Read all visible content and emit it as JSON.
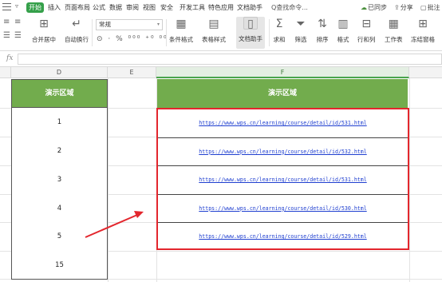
{
  "menubar": {
    "start_tab": "开始",
    "items": [
      "插入",
      "页面布局",
      "公式",
      "数据",
      "审阅",
      "视图",
      "安全",
      "开发工具",
      "特色应用",
      "文档助手"
    ],
    "search_placeholder": "Q查找命令...",
    "sync_label": "已同步",
    "share_label": "分享",
    "comment_label": "批注"
  },
  "ribbon": {
    "merge_center": "合并居中",
    "wrap_text": "自动换行",
    "number_format": "常规",
    "conditional_format": "条件格式",
    "table_style": "表格样式",
    "doc_helper": "文档助手",
    "sum": "求和",
    "filter": "筛选",
    "sort": "排序",
    "format": "格式",
    "row_col": "行和列",
    "worksheet": "工作表",
    "freeze": "冻结窗格"
  },
  "formula_bar": {
    "fx_label": "fx",
    "value": ""
  },
  "columns": {
    "d": "D",
    "e": "E",
    "f": "F"
  },
  "table_d": {
    "header": "演示区域",
    "values": [
      "1",
      "2",
      "3",
      "4",
      "5",
      "15"
    ]
  },
  "table_f": {
    "header": "演示区域",
    "links": [
      "https://www.wps.cn/learning/course/detail/id/531.html",
      "https://www.wps.cn/learning/course/detail/id/532.html",
      "https://www.wps.cn/learning/course/detail/id/531.html",
      "https://www.wps.cn/learning/course/detail/id/530.html",
      "https://www.wps.cn/learning/course/detail/id/529.html"
    ]
  },
  "colors": {
    "header_green": "#72ac4d",
    "start_tab_green": "#35a04a",
    "highlight_red": "#e3262d",
    "link_blue": "#1f3fd0"
  }
}
